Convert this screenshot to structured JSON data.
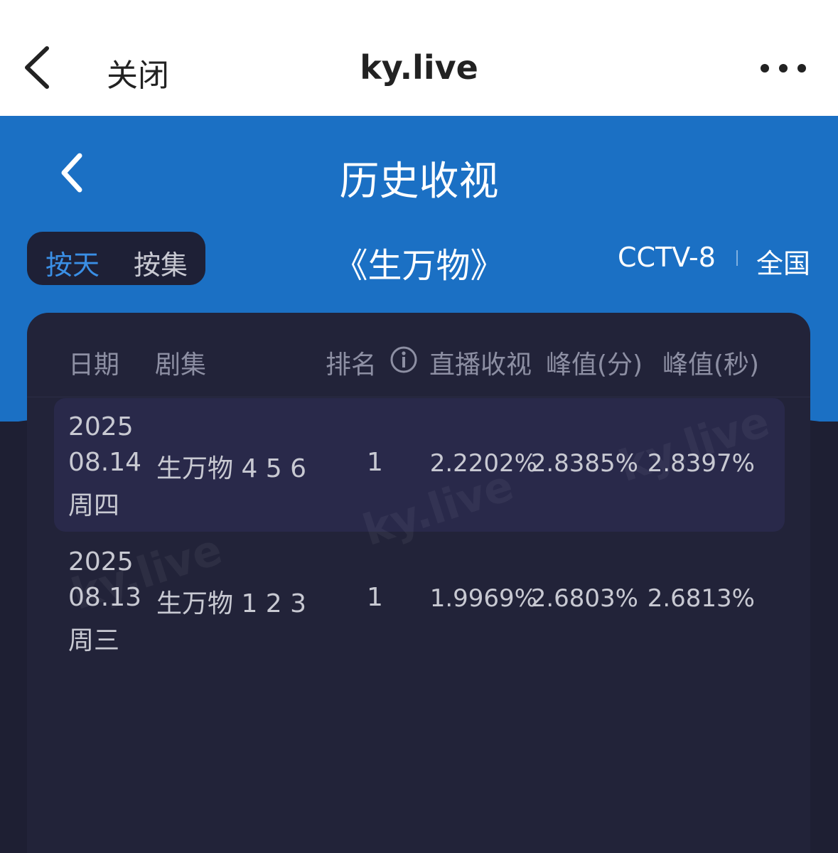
{
  "topbar": {
    "close_label": "关闭",
    "title": "ky.live"
  },
  "header": {
    "title": "历史收视"
  },
  "toggle": {
    "by_day": "按天",
    "by_episode": "按集"
  },
  "program": {
    "title": "《生万物》",
    "channel": "CCTV-8",
    "region": "全国"
  },
  "table": {
    "columns": [
      "日期",
      "剧集",
      "排名",
      "直播收视",
      "峰值(分)",
      "峰值(秒)"
    ],
    "rows": [
      {
        "year": "2025",
        "date": "08.14",
        "weekday": "周四",
        "episodes": "生万物 4 5 6",
        "rank": "1",
        "live": "2.2202%",
        "peak_min": "2.8385%",
        "peak_sec": "2.8397%"
      },
      {
        "year": "2025",
        "date": "08.13",
        "weekday": "周三",
        "episodes": "生万物 1 2 3",
        "rank": "1",
        "live": "1.9969%",
        "peak_min": "2.6803%",
        "peak_sec": "2.6813%"
      }
    ]
  },
  "watermark": "ky.live",
  "colors": {
    "header_blue": "#1b70c4",
    "card_bg": "#222339",
    "accent": "#3a8fe6"
  }
}
